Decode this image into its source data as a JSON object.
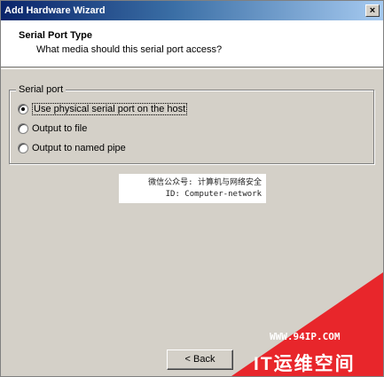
{
  "window": {
    "title": "Add Hardware Wizard",
    "close_label": "×"
  },
  "header": {
    "title": "Serial Port Type",
    "subtitle": "What media should this serial port access?"
  },
  "serial_port_group": {
    "legend": "Serial port",
    "options": [
      {
        "label": "Use physical serial port on the host",
        "checked": true
      },
      {
        "label": "Output to file",
        "checked": false
      },
      {
        "label": "Output to named pipe",
        "checked": false
      }
    ]
  },
  "watermark": {
    "line1": "微信公众号: 计算机与网络安全",
    "line2": "ID: Computer-network"
  },
  "buttons": {
    "back_label": "< Back"
  },
  "corner_brand": {
    "url": "WWW.94IP.COM",
    "name": "IT运维空间",
    "color": "#e8262b"
  }
}
